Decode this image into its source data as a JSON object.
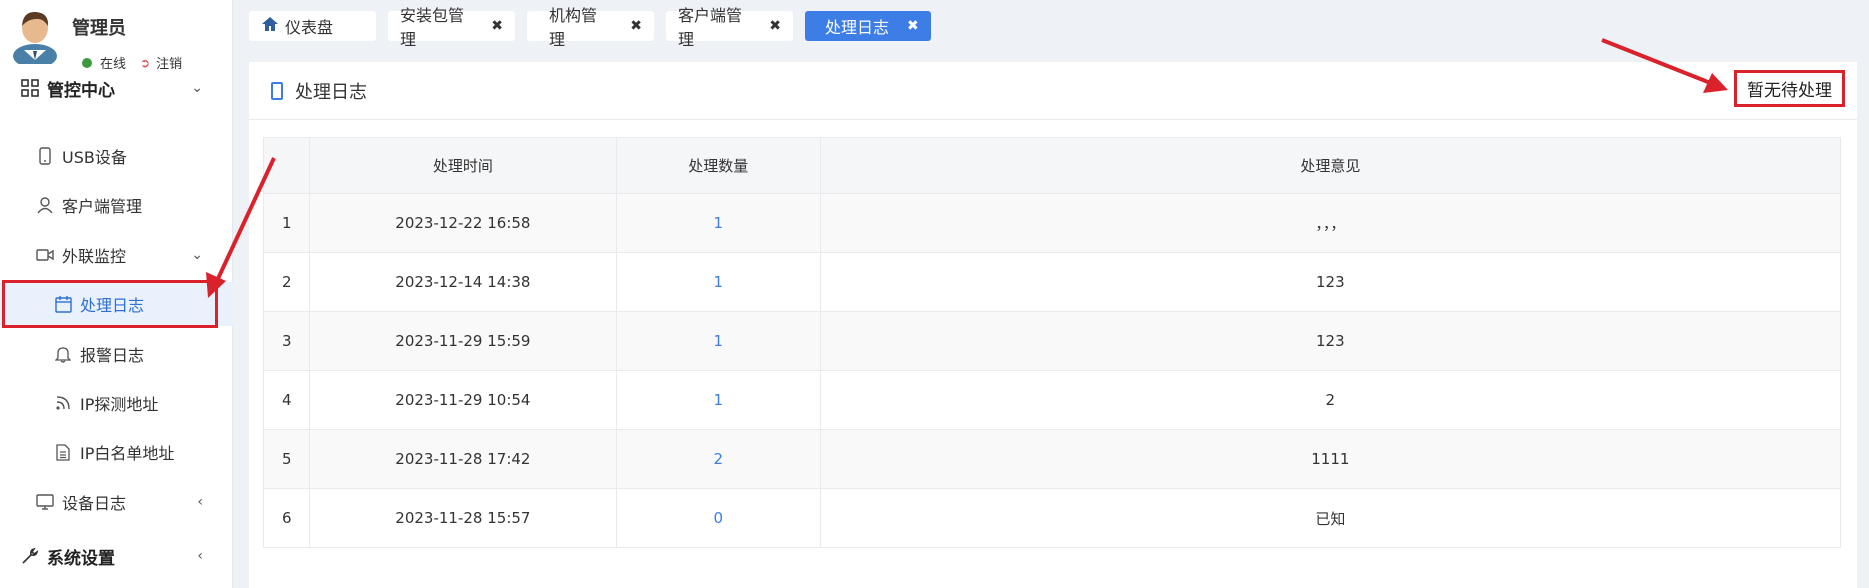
{
  "user": {
    "name": "管理员",
    "status": "在线",
    "logout": "注销"
  },
  "sidebar": {
    "group_admin": "管控中心",
    "items": [
      {
        "label": "USB设备",
        "icon": "phone-icon"
      },
      {
        "label": "客户端管理",
        "icon": "user-icon"
      },
      {
        "label": "外联监控",
        "icon": "camera-icon"
      }
    ],
    "sub_items": [
      {
        "label": "处理日志",
        "icon": "calendar-icon",
        "active": true
      },
      {
        "label": "报警日志",
        "icon": "bell-icon"
      },
      {
        "label": "IP探测地址",
        "icon": "rss-icon"
      },
      {
        "label": "IP白名单地址",
        "icon": "file-icon"
      }
    ],
    "device_log": "设备日志",
    "group_system": "系统设置"
  },
  "tabs": [
    {
      "label": "仪表盘",
      "icon": "home-icon",
      "closable": false
    },
    {
      "label": "安装包管理",
      "closable": true
    },
    {
      "label": "机构管理",
      "closable": true
    },
    {
      "label": "客户端管理",
      "closable": true
    },
    {
      "label": "处理日志",
      "closable": true,
      "active": true
    }
  ],
  "panel": {
    "title": "处理日志",
    "pending_button": "暂无待处理"
  },
  "table": {
    "headers": [
      "",
      "处理时间",
      "处理数量",
      "处理意见"
    ],
    "rows": [
      [
        "1",
        "2023-12-22 16:58",
        "1",
        "，，，"
      ],
      [
        "2",
        "2023-12-14 14:38",
        "1",
        "123"
      ],
      [
        "3",
        "2023-11-29 15:59",
        "1",
        "123"
      ],
      [
        "4",
        "2023-11-29 10:54",
        "1",
        "2"
      ],
      [
        "5",
        "2023-11-28 17:42",
        "2",
        "1111"
      ],
      [
        "6",
        "2023-11-28 15:57",
        "0",
        "已知"
      ]
    ]
  },
  "colors": {
    "accent": "#3c7ee6",
    "highlight": "#d9222b",
    "online": "#3c9a3c"
  }
}
